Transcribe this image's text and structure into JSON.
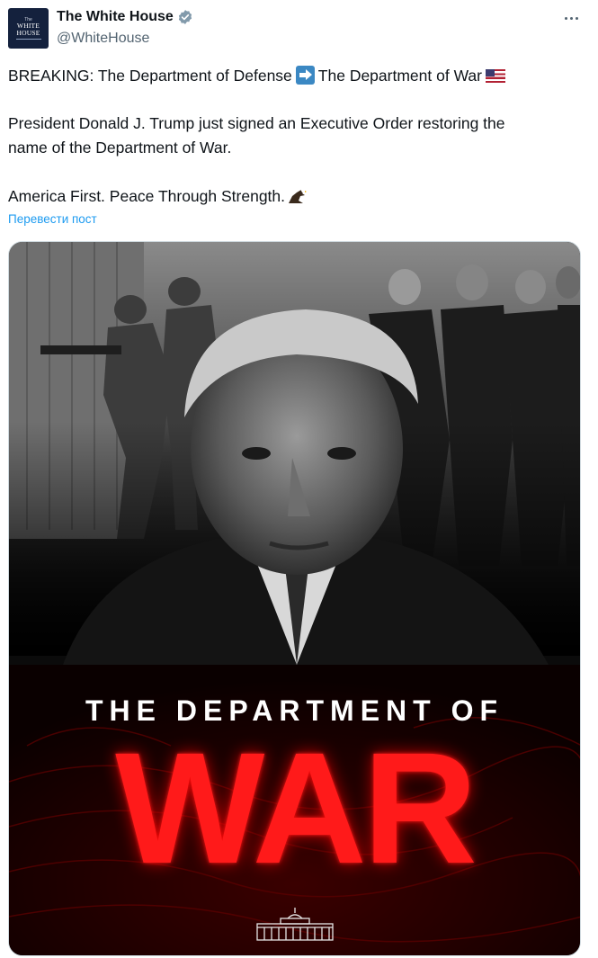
{
  "account": {
    "display_name": "The White House",
    "handle": "@WhiteHouse",
    "avatar_text": [
      "The",
      "WHITE",
      "HOUSE"
    ],
    "verified_color": "#829aab"
  },
  "tweet": {
    "line1_a": "BREAKING: The Department of Defense",
    "line1_b": "The Department of War",
    "line2": "President Donald J. Trump just signed an Executive Order restoring the",
    "line3": "name of the Department of War.",
    "line4": "America First. Peace Through Strength.",
    "translate_link": "Перевести пост"
  },
  "media": {
    "headline_small": "THE DEPARTMENT OF",
    "headline_big": "WAR",
    "accent_color": "#ff1a1a"
  },
  "icons": [
    "verified-badge-icon",
    "more-options-icon",
    "right-arrow-emoji-icon",
    "us-flag-emoji-icon",
    "eagle-emoji-icon",
    "white-house-logo-icon"
  ]
}
